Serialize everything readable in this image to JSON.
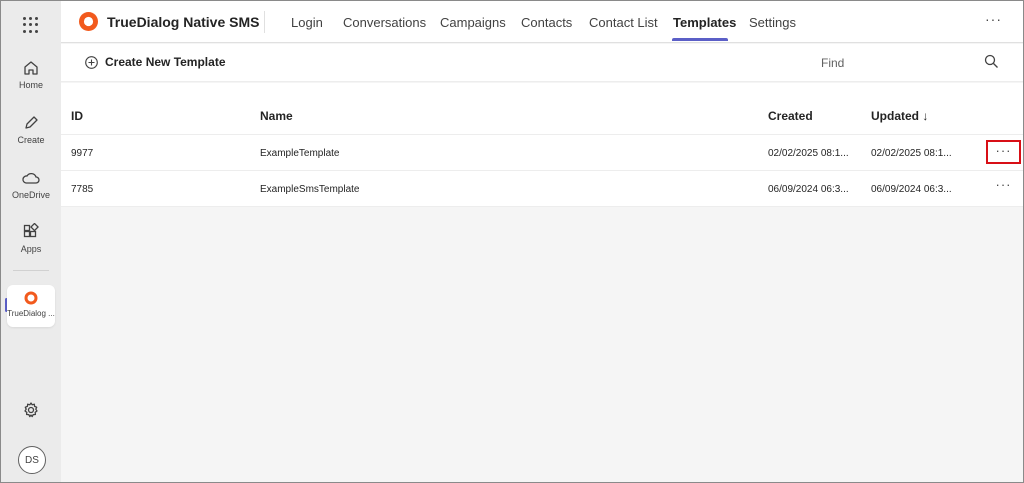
{
  "rail": {
    "items": [
      {
        "label": "Home",
        "icon": "home-icon"
      },
      {
        "label": "Create",
        "icon": "pen-icon"
      },
      {
        "label": "OneDrive",
        "icon": "cloud-icon"
      },
      {
        "label": "Apps",
        "icon": "apps-icon"
      }
    ],
    "app": {
      "label": "TrueDialog ...",
      "icon": "truedialog-logo"
    },
    "settings_icon": "gear-icon",
    "avatar": "DS"
  },
  "header": {
    "app_name": "TrueDialog Native SMS",
    "brand_color": "#f25a1d",
    "tabs": [
      {
        "label": "Login"
      },
      {
        "label": "Conversations"
      },
      {
        "label": "Campaigns"
      },
      {
        "label": "Contacts"
      },
      {
        "label": "Contact List"
      },
      {
        "label": "Templates",
        "active": true
      },
      {
        "label": "Settings"
      }
    ],
    "more": "···"
  },
  "toolbar": {
    "create_label": "Create New Template",
    "find_placeholder": "Find"
  },
  "table": {
    "columns": {
      "id": "ID",
      "name": "Name",
      "created": "Created",
      "updated": "Updated ↓"
    },
    "rows": [
      {
        "id": "9977",
        "name": "ExampleTemplate",
        "created": "02/02/2025 08:1...",
        "updated": "02/02/2025 08:1...",
        "more": "···"
      },
      {
        "id": "7785",
        "name": "ExampleSmsTemplate",
        "created": "06/09/2024 06:3...",
        "updated": "06/09/2024 06:3...",
        "more": "···"
      }
    ]
  },
  "colors": {
    "accent": "#5b5fc7",
    "highlight": "#d80f16"
  }
}
